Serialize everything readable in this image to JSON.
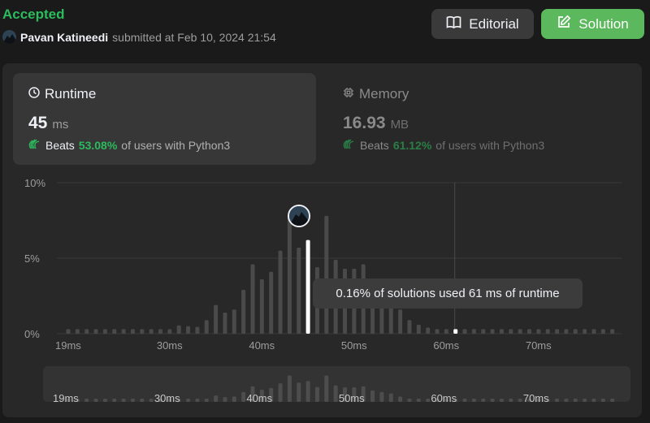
{
  "status": "Accepted",
  "submission": {
    "user": "Pavan Katineedi",
    "submitted_text": "submitted at Feb 10, 2024 21:54"
  },
  "buttons": {
    "editorial_label": "Editorial",
    "solution_label": "Solution"
  },
  "runtime": {
    "title": "Runtime",
    "value": "45",
    "unit": "ms",
    "beats_label": "Beats",
    "beats_pct": "53.08%",
    "beats_suffix": "of users with Python3"
  },
  "memory": {
    "title": "Memory",
    "value": "16.93",
    "unit": "MB",
    "beats_label": "Beats",
    "beats_pct": "61.12%",
    "beats_suffix": "of users with Python3"
  },
  "tooltip": "0.16% of solutions used 61 ms of runtime",
  "colors": {
    "accent_green": "#2cbb5d",
    "solution_button": "#5cb85c",
    "bar": "#4a4a4a",
    "selected_bar": "#ffffff"
  },
  "icons": {
    "editorial": "book-icon",
    "solution": "edit-icon",
    "runtime": "clock-icon",
    "memory": "chip-icon",
    "beats": "clap-icon"
  },
  "chart_data": {
    "type": "bar",
    "ylabel": "",
    "xlabel": "",
    "y_ticks": [
      "10%",
      "5%",
      "0%"
    ],
    "ylim": [
      0,
      10
    ],
    "xlim": [
      18,
      79
    ],
    "x_ticks": [
      {
        "label": "19ms",
        "value": 19
      },
      {
        "label": "30ms",
        "value": 30
      },
      {
        "label": "40ms",
        "value": 40
      },
      {
        "label": "50ms",
        "value": 50
      },
      {
        "label": "60ms",
        "value": 60
      },
      {
        "label": "70ms",
        "value": 70
      }
    ],
    "x": [
      19,
      20,
      21,
      22,
      23,
      24,
      25,
      26,
      27,
      28,
      29,
      30,
      31,
      32,
      33,
      34,
      35,
      36,
      37,
      38,
      39,
      40,
      41,
      42,
      43,
      44,
      45,
      46,
      47,
      48,
      49,
      50,
      51,
      52,
      53,
      54,
      55,
      56,
      57,
      58,
      59,
      60,
      61,
      62,
      63,
      64,
      65,
      66,
      67,
      68,
      69,
      70,
      71,
      72,
      73,
      74,
      75,
      76,
      77,
      78
    ],
    "values": [
      0.3,
      0.3,
      0.3,
      0.3,
      0.3,
      0.3,
      0.3,
      0.3,
      0.3,
      0.3,
      0.3,
      0.3,
      0.55,
      0.5,
      0.45,
      0.9,
      1.9,
      1.4,
      1.6,
      2.9,
      4.6,
      3.6,
      4.1,
      5.5,
      7.8,
      5.7,
      6.2,
      4.4,
      7.8,
      4.9,
      4.3,
      4.3,
      4.6,
      3.4,
      2.9,
      2.5,
      1.6,
      0.9,
      0.6,
      0.4,
      0.3,
      0.3,
      0.3,
      0.3,
      0.3,
      0.3,
      0.3,
      0.3,
      0.3,
      0.3,
      0.3,
      0.3,
      0.3,
      0.3,
      0.3,
      0.3,
      0.3,
      0.3,
      0.3,
      0.3
    ],
    "user_runtime": 45,
    "user_value": 6.2,
    "hover_runtime": 61,
    "hover_value": 0.16,
    "grid": true,
    "overview_x_ticks": [
      "19ms",
      "30ms",
      "40ms",
      "50ms",
      "60ms",
      "70ms"
    ]
  }
}
